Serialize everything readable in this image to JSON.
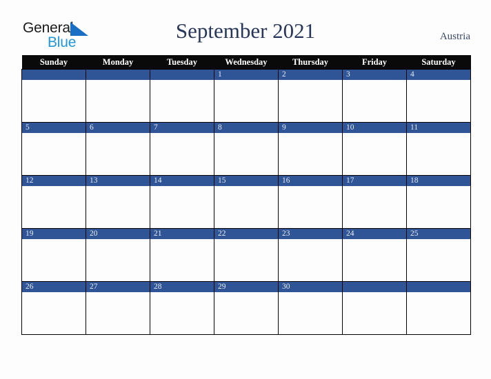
{
  "logo": {
    "word_one": "General",
    "word_two": "Blue",
    "triangle_icon": "triangle-icon",
    "dark_color": "#1b1b1b",
    "blue_color": "#2196d8"
  },
  "header": {
    "title": "September 2021",
    "country": "Austria",
    "title_color": "#27375c"
  },
  "calendar": {
    "weekday_headers": [
      "Sunday",
      "Monday",
      "Tuesday",
      "Wednesday",
      "Thursday",
      "Friday",
      "Saturday"
    ],
    "header_bg": "#0a0a0a",
    "daynum_bg": "#2f5597",
    "daynum_color": "#e8ecf4",
    "cell_bg": "#fdfdfd",
    "grid_line_color": "#000000",
    "weeks": [
      [
        "",
        "",
        "",
        "1",
        "2",
        "3",
        "4"
      ],
      [
        "5",
        "6",
        "7",
        "8",
        "9",
        "10",
        "11"
      ],
      [
        "12",
        "13",
        "14",
        "15",
        "16",
        "17",
        "18"
      ],
      [
        "19",
        "20",
        "21",
        "22",
        "23",
        "24",
        "25"
      ],
      [
        "26",
        "27",
        "28",
        "29",
        "30",
        "",
        ""
      ]
    ]
  }
}
